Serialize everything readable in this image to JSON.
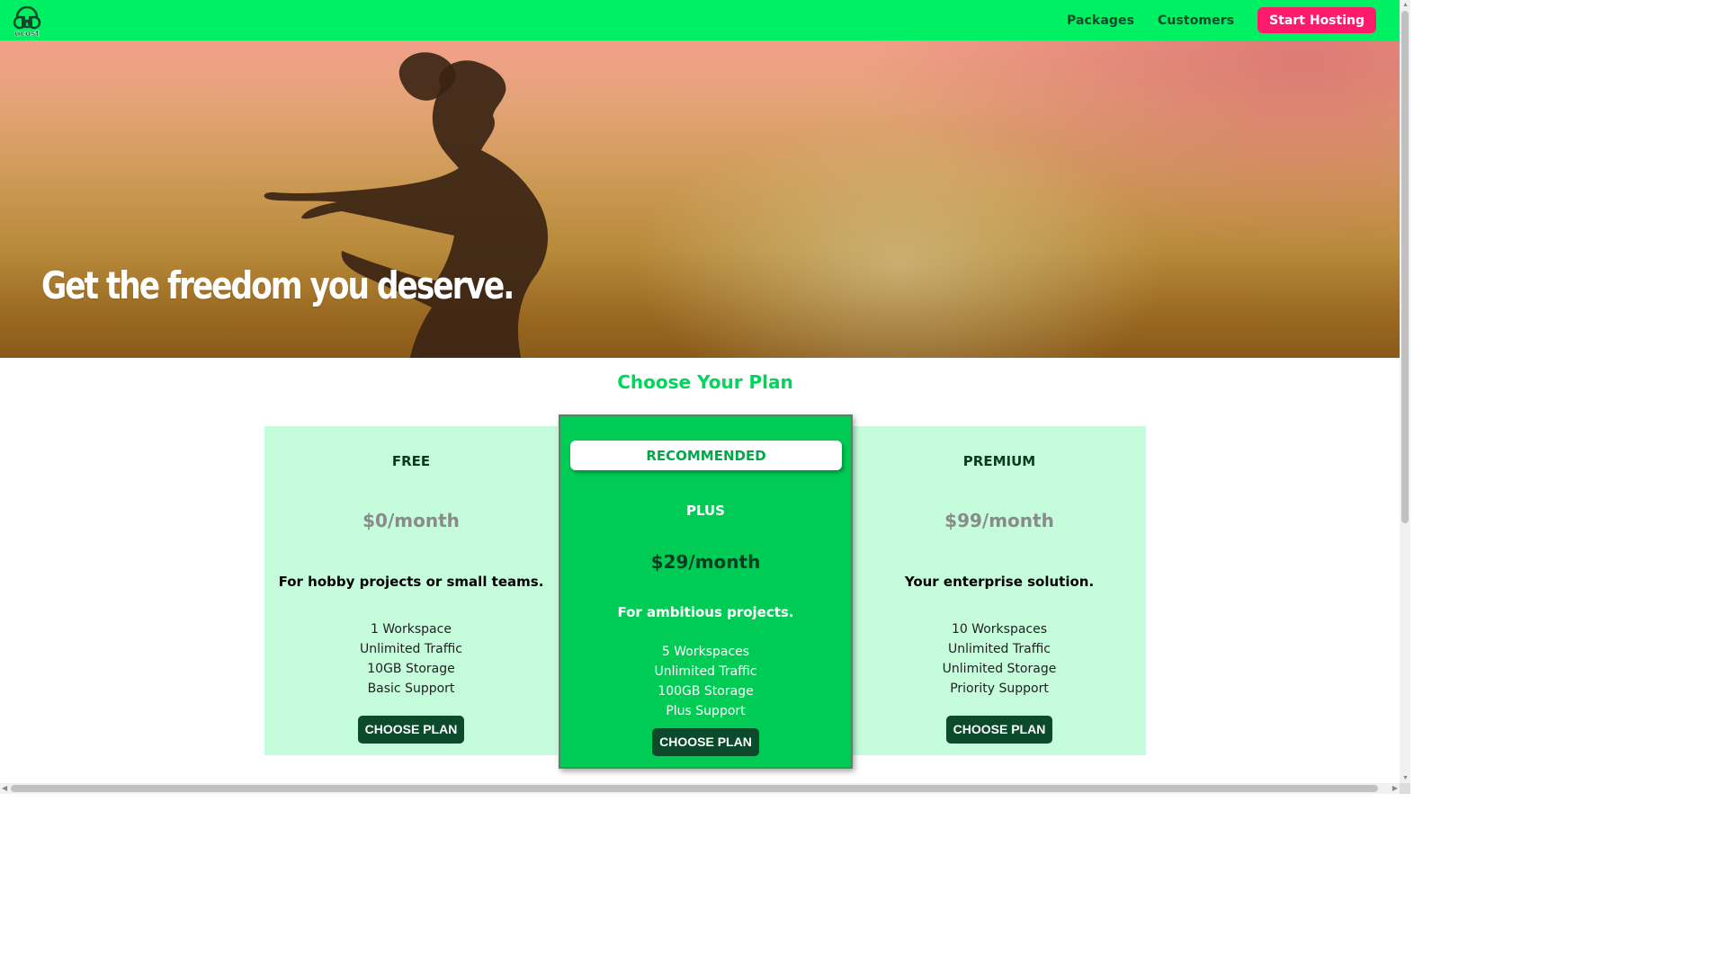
{
  "header": {
    "logo_text": "ucost",
    "nav": [
      "Packages",
      "Customers"
    ],
    "cta_label": "Start Hosting"
  },
  "hero": {
    "title": "Get the freedom you deserve."
  },
  "plans_section": {
    "title": "Choose Your Plan",
    "plans": [
      {
        "name": "FREE",
        "price": "$0/month",
        "description": "For hobby projects or small teams.",
        "features": [
          "1 Workspace",
          "Unlimited Traffic",
          "10GB Storage",
          "Basic Support"
        ],
        "button_label": "CHOOSE PLAN"
      },
      {
        "badge": "RECOMMENDED",
        "name": "PLUS",
        "price": "$29/month",
        "description": "For ambitious projects.",
        "features": [
          "5 Workspaces",
          "Unlimited Traffic",
          "100GB Storage",
          "Plus Support"
        ],
        "button_label": "CHOOSE PLAN"
      },
      {
        "name": "PREMIUM",
        "price": "$99/month",
        "description": "Your enterprise solution.",
        "features": [
          "10 Workspaces",
          "Unlimited Traffic",
          "Unlimited Storage",
          "Priority Support"
        ],
        "button_label": "CHOOSE PLAN"
      }
    ]
  },
  "colors": {
    "header_bg": "#00f064",
    "cta_bg": "#ff1b6b",
    "accent_green": "#00d65c",
    "plan_bg_light": "#c4fcdc",
    "plan_bg_recommended": "#00cc55",
    "button_dark_green": "#0b4a2a"
  }
}
